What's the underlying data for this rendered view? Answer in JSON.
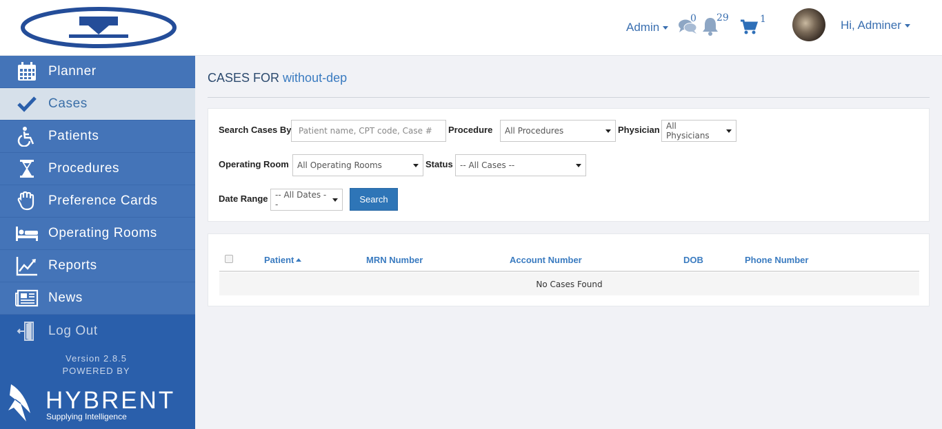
{
  "header": {
    "role_menu": "Admin",
    "messages_count": "0",
    "notifications_count": "29",
    "cart_count": "1",
    "greeting": "Hi, Adminer"
  },
  "sidebar": {
    "items": [
      {
        "label": "Planner",
        "icon": "calendar-icon"
      },
      {
        "label": "Cases",
        "icon": "checkmark-icon"
      },
      {
        "label": "Patients",
        "icon": "wheelchair-icon"
      },
      {
        "label": "Procedures",
        "icon": "hourglass-icon"
      },
      {
        "label": "Preference Cards",
        "icon": "hand-icon"
      },
      {
        "label": "Operating Rooms",
        "icon": "bed-icon"
      },
      {
        "label": "Reports",
        "icon": "line-chart-icon"
      },
      {
        "label": "News",
        "icon": "newspaper-icon"
      },
      {
        "label": "Log Out",
        "icon": "door-exit-icon"
      }
    ],
    "version": "Version 2.8.5",
    "powered_by": "POWERED BY",
    "brand_name": "HYBRENT",
    "brand_tagline": "Supplying Intelligence"
  },
  "page": {
    "title_prefix": "CASES FOR",
    "title_accent": "without-dep"
  },
  "search": {
    "search_by_label": "Search Cases By",
    "search_placeholder": "Patient name, CPT code, Case #",
    "procedure_label": "Procedure",
    "procedure_value": "All Procedures",
    "physician_label": "Physician",
    "physician_value": "All Physicians",
    "room_label": "Operating Room",
    "room_value": "All Operating Rooms",
    "status_label": "Status",
    "status_value": "-- All Cases --",
    "date_label": "Date Range",
    "date_value": "-- All Dates --",
    "button": "Search"
  },
  "table": {
    "columns": [
      "Patient",
      "MRN Number",
      "Account Number",
      "DOB",
      "Phone Number"
    ],
    "empty_message": "No Cases Found"
  },
  "colors": {
    "sidebar": "#4474b8",
    "sidebar_bottom": "#2a5fab",
    "accent": "#3a7bc0",
    "active_item": "#d6e0ea"
  }
}
